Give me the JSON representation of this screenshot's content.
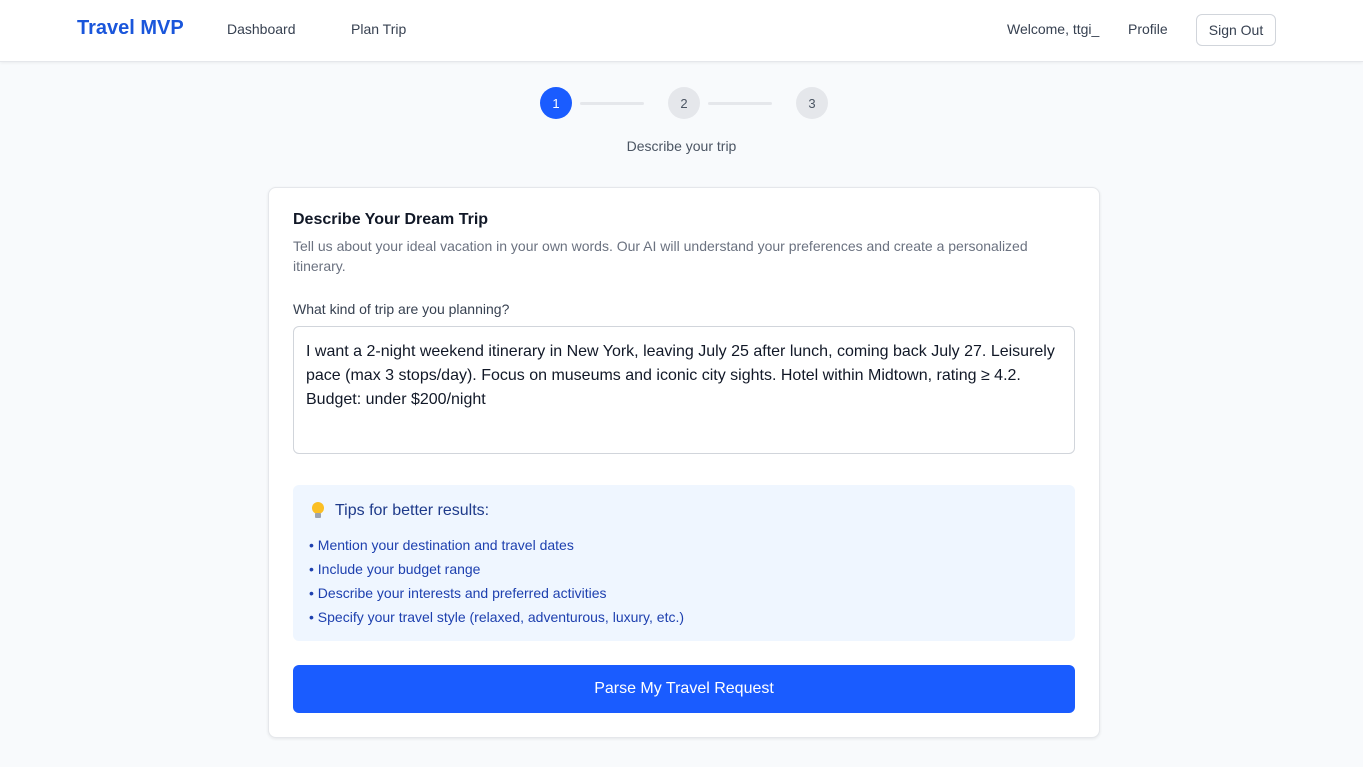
{
  "nav": {
    "brand": "Travel MVP",
    "links": [
      "Dashboard",
      "Plan Trip"
    ],
    "welcome": "Welcome, ttgi_",
    "profile": "Profile",
    "sign_out": "Sign Out"
  },
  "stepper": {
    "steps": [
      "1",
      "2",
      "3"
    ],
    "active_step": 1,
    "caption": "Describe your trip"
  },
  "card": {
    "title": "Describe Your Dream Trip",
    "description": "Tell us about your ideal vacation in your own words. Our AI will understand your preferences and create a personalized itinerary.",
    "field_label": "What kind of trip are you planning?",
    "trip_text": "I want a 2-night weekend itinerary in New York, leaving July 25 after lunch, coming back July 27. Leisurely pace (max 3 stops/day). Focus on museums and iconic city sights. Hotel within Midtown, rating ≥ 4.2. Budget: under $200/night",
    "tips": {
      "heading": "Tips for better results:",
      "icon": "lightbulb-icon",
      "items": [
        "Mention your destination and travel dates",
        "Include your budget range",
        "Describe your interests and preferred activities",
        "Specify your travel style (relaxed, adventurous, luxury, etc.)"
      ]
    },
    "submit_label": "Parse My Travel Request"
  },
  "colors": {
    "accent": "#1a5cff",
    "brand": "#1a56db",
    "tips_bg": "#eff6ff",
    "tips_text": "#1e40af"
  }
}
